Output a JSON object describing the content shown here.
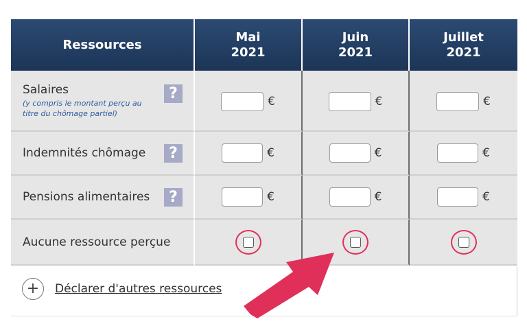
{
  "header": {
    "resources": "Ressources",
    "months": [
      {
        "month": "Mai",
        "year": "2021"
      },
      {
        "month": "Juin",
        "year": "2021"
      },
      {
        "month": "Juillet",
        "year": "2021"
      }
    ]
  },
  "rows": [
    {
      "label": "Salaires",
      "sublabel_line1": "(y compris le montant perçu au",
      "sublabel_line2": "titre du chômage partiel)"
    },
    {
      "label": "Indemnités chômage"
    },
    {
      "label": "Pensions alimentaires"
    },
    {
      "label": "Aucune ressource perçue"
    }
  ],
  "help_glyph": "?",
  "currency": "€",
  "footer": {
    "plus": "+",
    "link": "Déclarer d'autres ressources"
  },
  "colors": {
    "header_bg": "#1c3557",
    "row_bg": "#e6e6e6",
    "annotation": "#e0305a",
    "sublabel": "#2c5aa0"
  },
  "icons": [
    "help-icon",
    "plus-icon",
    "annotation-arrow-icon",
    "annotation-circle"
  ]
}
